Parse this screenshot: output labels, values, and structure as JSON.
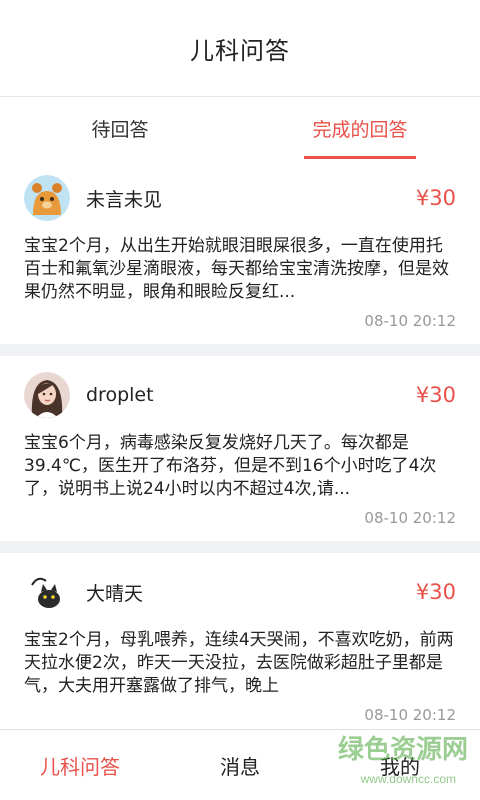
{
  "header": {
    "title": "儿科问答"
  },
  "tabs": [
    {
      "label": "待回答",
      "active": false
    },
    {
      "label": "完成的回答",
      "active": true
    }
  ],
  "questions": [
    {
      "user": "未言未见",
      "avatar": "bear-avatar",
      "price": "¥30",
      "text": "宝宝2个月，从出生开始就眼泪眼屎很多，一直在使用托百士和氟氧沙星滴眼液，每天都给宝宝清洗按摩，但是效果仍然不明显，眼角和眼睑反复红...",
      "time": "08-10 20:12"
    },
    {
      "user": "droplet",
      "avatar": "woman-avatar",
      "price": "¥30",
      "text": "宝宝6个月，病毒感染反复发烧好几天了。每次都是39.4℃，医生开了布洛芬，但是不到16个小时吃了4次了，说明书上说24小时以内不超过4次,请...",
      "time": "08-10 20:12"
    },
    {
      "user": "大晴天",
      "avatar": "cat-avatar",
      "price": "¥30",
      "text": "宝宝2个月，母乳喂养，连续4天哭闹，不喜欢吃奶，前两天拉水便2次，昨天一天没拉，去医院做彩超肚子里都是气，大夫用开塞露做了排气，晚上",
      "time": "08-10 20:12"
    }
  ],
  "bottom_nav": [
    {
      "label": "儿科问答",
      "active": true
    },
    {
      "label": "消息",
      "active": false
    },
    {
      "label": "我的",
      "active": false
    }
  ],
  "watermark": {
    "text": "绿色资源网",
    "url": "www.downcc.com"
  },
  "colors": {
    "accent": "#e9514a",
    "separator": "#eff1f5",
    "time": "#999999"
  }
}
